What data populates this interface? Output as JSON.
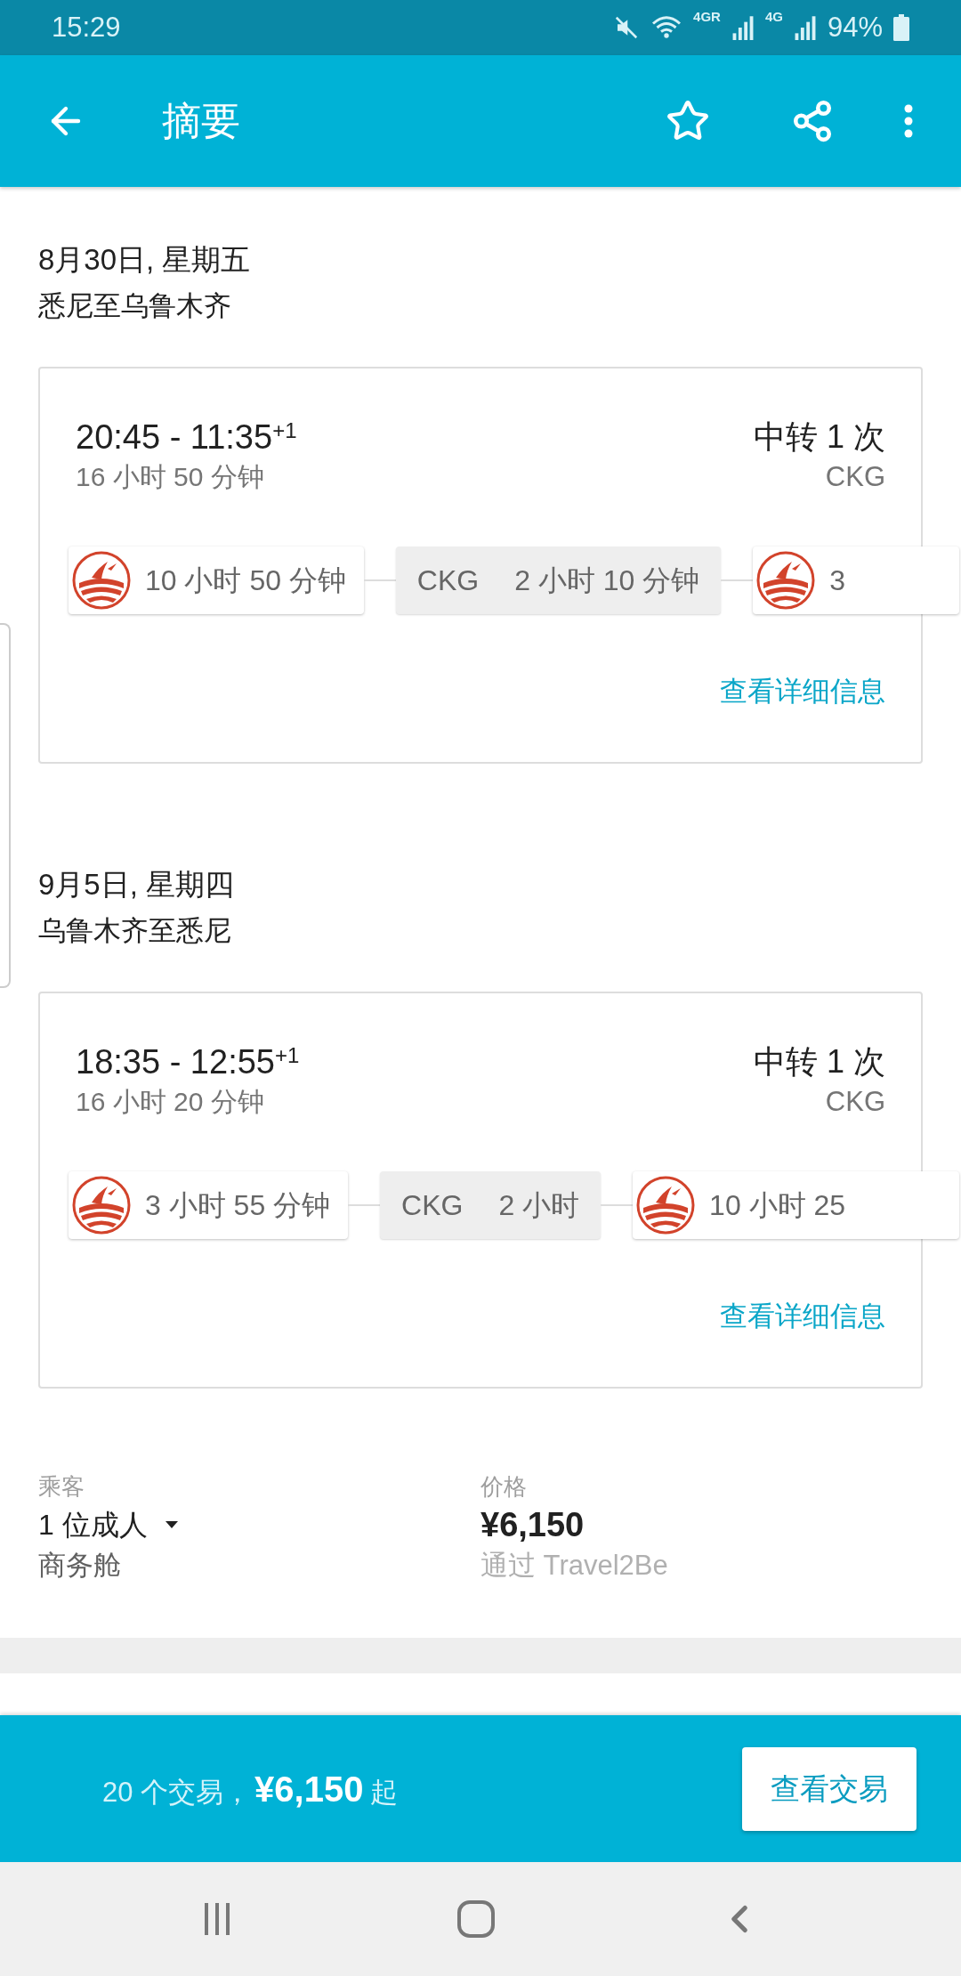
{
  "status_bar": {
    "time": "15:29",
    "network_1": "4GR",
    "network_2": "4G",
    "battery": "94%"
  },
  "app_bar": {
    "title": "摘要"
  },
  "trips": [
    {
      "date": "8月30日, 星期五",
      "route": "悉尼至乌鲁木齐",
      "times": "20:45 - 11:35",
      "day_offset": "+1",
      "duration": "16 小时 50 分钟",
      "stops": "中转 1 次",
      "via": "CKG",
      "segments": [
        {
          "kind": "flight",
          "duration": "10 小时 50 分钟"
        },
        {
          "kind": "layover",
          "airport": "CKG",
          "duration": "2 小时 10 分钟"
        },
        {
          "kind": "flight",
          "duration": "3"
        }
      ],
      "details_link": "查看详细信息"
    },
    {
      "date": "9月5日, 星期四",
      "route": "乌鲁木齐至悉尼",
      "times": "18:35 - 12:55",
      "day_offset": "+1",
      "duration": "16 小时 20 分钟",
      "stops": "中转 1 次",
      "via": "CKG",
      "segments": [
        {
          "kind": "flight",
          "duration": "3 小时 55 分钟"
        },
        {
          "kind": "layover",
          "airport": "CKG",
          "duration": "2 小时"
        },
        {
          "kind": "flight",
          "duration": "10 小时 25"
        }
      ],
      "details_link": "查看详细信息"
    }
  ],
  "summary": {
    "passengers_label": "乘客",
    "passengers": "1 位成人",
    "cabin": "商务舱",
    "price_label": "价格",
    "price": "¥6,150",
    "provider": "通过 Travel2Be"
  },
  "deals_bar": {
    "count": "20 个交易，",
    "price": "¥6,150",
    "suffix": "起",
    "button": "查看交易"
  }
}
